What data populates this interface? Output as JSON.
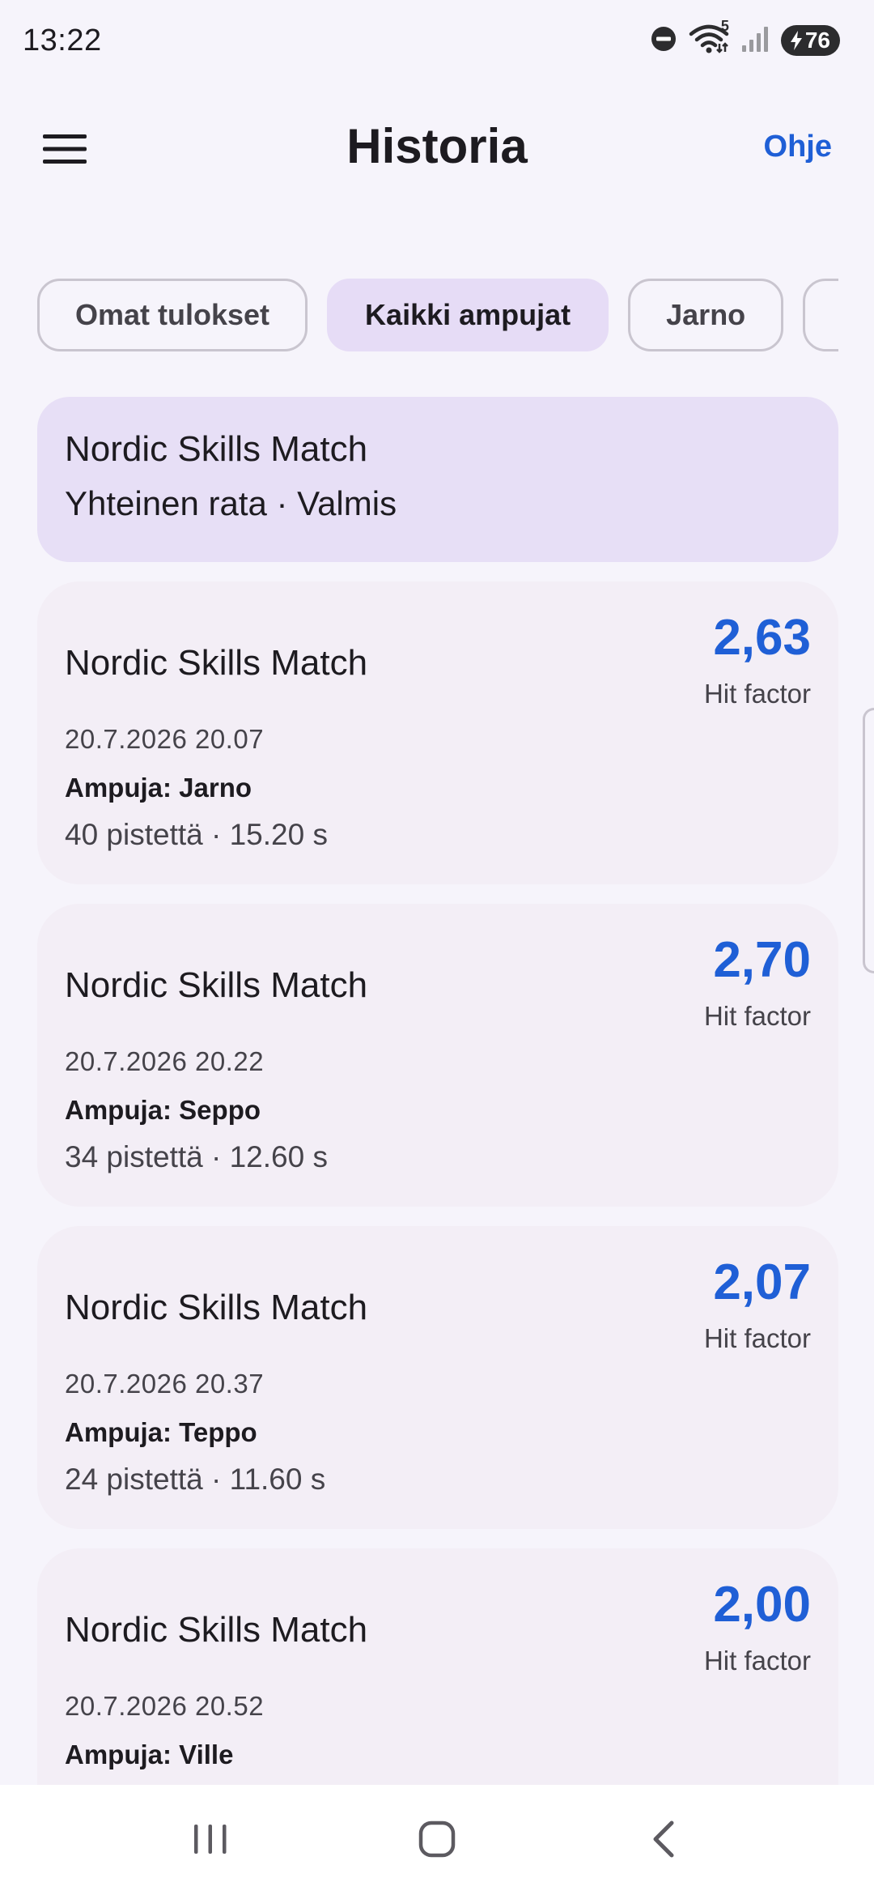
{
  "status": {
    "time": "13:22",
    "battery": "76",
    "signal_superscript": "5"
  },
  "app_bar": {
    "title": "Historia",
    "help_label": "Ohje"
  },
  "filters": [
    {
      "label": "Omat tulokset",
      "selected": false
    },
    {
      "label": "Kaikki ampujat",
      "selected": true
    },
    {
      "label": "Jarno",
      "selected": false
    },
    {
      "label": "",
      "selected": false
    }
  ],
  "header": {
    "title": "Nordic Skills Match",
    "subtitle": "Yhteinen rata · Valmis"
  },
  "results": [
    {
      "title": "Nordic Skills Match",
      "date": "20.7.2026 20.07",
      "shooter": "Ampuja: Jarno",
      "score": "40 pistettä · 15.20 s",
      "hit_factor": "2,63",
      "hit_factor_label": "Hit factor"
    },
    {
      "title": "Nordic Skills Match",
      "date": "20.7.2026 20.22",
      "shooter": "Ampuja: Seppo",
      "score": "34 pistettä · 12.60 s",
      "hit_factor": "2,70",
      "hit_factor_label": "Hit factor"
    },
    {
      "title": "Nordic Skills Match",
      "date": "20.7.2026 20.37",
      "shooter": "Ampuja: Teppo",
      "score": "24 pistettä · 11.60 s",
      "hit_factor": "2,07",
      "hit_factor_label": "Hit factor"
    },
    {
      "title": "Nordic Skills Match",
      "date": "20.7.2026 20.52",
      "shooter": "Ampuja: Ville",
      "score": "",
      "hit_factor": "2,00",
      "hit_factor_label": "Hit factor"
    }
  ],
  "colors": {
    "accent": "#1f5fd6",
    "selected_chip": "#e6dcf6",
    "header_card": "#e7dff6",
    "card": "#f3eef6",
    "background": "#f6f4fb"
  },
  "icons": {
    "menu": "hamburger-menu-icon",
    "dnd": "do-not-disturb-icon",
    "wifi": "wifi-icon",
    "signal": "cellular-signal-icon",
    "battery": "battery-charging-icon",
    "nav_recents": "recent-apps-icon",
    "nav_home": "home-icon",
    "nav_back": "back-icon"
  }
}
